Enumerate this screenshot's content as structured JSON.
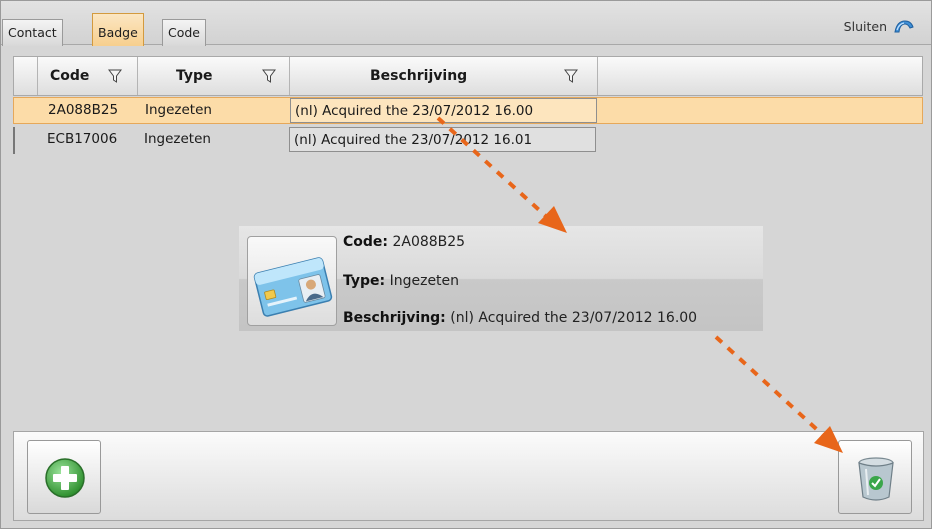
{
  "tabs": [
    {
      "label": "Contact",
      "active": false
    },
    {
      "label": "Badge",
      "active": true
    },
    {
      "label": "Code",
      "active": false
    }
  ],
  "close_label": "Sluiten",
  "grid": {
    "columns": [
      "Code",
      "Type",
      "Beschrijving"
    ],
    "rows": [
      {
        "code": "2A088B25",
        "type": "Ingezeten",
        "description": "(nl) Acquired the 23/07/2012 16.00",
        "selected": true
      },
      {
        "code": "ECB17006",
        "type": "Ingezeten",
        "description": "(nl) Acquired the 23/07/2012 16.01",
        "selected": false
      }
    ]
  },
  "tooltip": {
    "code_label": "Code:",
    "code_value": "2A088B25",
    "type_label": "Type:",
    "type_value": "Ingezeten",
    "description_label": "Beschrijving:",
    "description_value": "(nl) Acquired the 23/07/2012 16.00",
    "icon": "id-badge-card-icon"
  },
  "toolbar": {
    "add_icon": "add-plus-icon",
    "delete_icon": "trash-bin-icon"
  },
  "colors": {
    "selection": "#fcdca8",
    "active_tab": "#f7cf8e",
    "drag_arrow": "#e8661a",
    "add_green": "#3caa3c"
  }
}
